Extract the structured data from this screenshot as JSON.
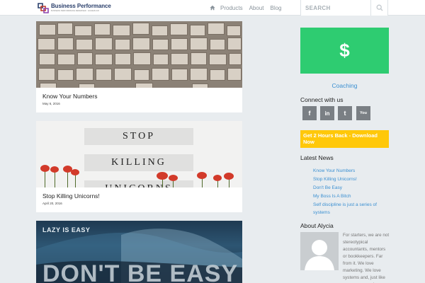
{
  "header": {
    "logo_name": "Business Performance",
    "logo_tagline": "BUSINESS PERFORMANCE REDEFINED · ACHIEVE EXCELLENCE",
    "nav": [
      "Products",
      "About",
      "Blog"
    ],
    "search_placeholder": "SEARCH"
  },
  "posts": [
    {
      "title": "Know Your Numbers",
      "date": "May 6, 2016"
    },
    {
      "title": "Stop Killing Unicorns!",
      "date": "April 20, 2016",
      "image_words": [
        "STOP",
        "KILLING",
        "UNICORNS"
      ]
    },
    {
      "image_text_small": "LAZY IS EASY",
      "image_text_big": "DON'T BE EASY"
    }
  ],
  "sidebar": {
    "cta_symbol": "$",
    "coaching": "Coaching",
    "connect_heading": "Connect with us",
    "social": [
      {
        "icon": "facebook-icon",
        "glyph": "f"
      },
      {
        "icon": "linkedin-icon",
        "glyph": "in"
      },
      {
        "icon": "twitter-icon",
        "glyph": "t"
      },
      {
        "icon": "youtube-icon",
        "glyph": "You"
      }
    ],
    "download_label": "Get 2 Hours Back - Download Now",
    "latest_news_heading": "Latest News",
    "latest_news": [
      "Know Your Numbers",
      "Stop Killing Unicorns!",
      "Don't Be Easy",
      "My Boss Is A Bitch",
      "Self discipline is just a series of systems"
    ],
    "about_heading": "About Alycia",
    "about_text": "For starters, we are not stereotypical accountants, mentors or bookkeepers. Far from it. We love marketing. We love systems and, just like you, our eyes glaze"
  },
  "colors": {
    "accent_green": "#2ecc71",
    "accent_yellow": "#ffc80a",
    "link_blue": "#3a8fd1",
    "social_gray": "#7a7f84"
  }
}
